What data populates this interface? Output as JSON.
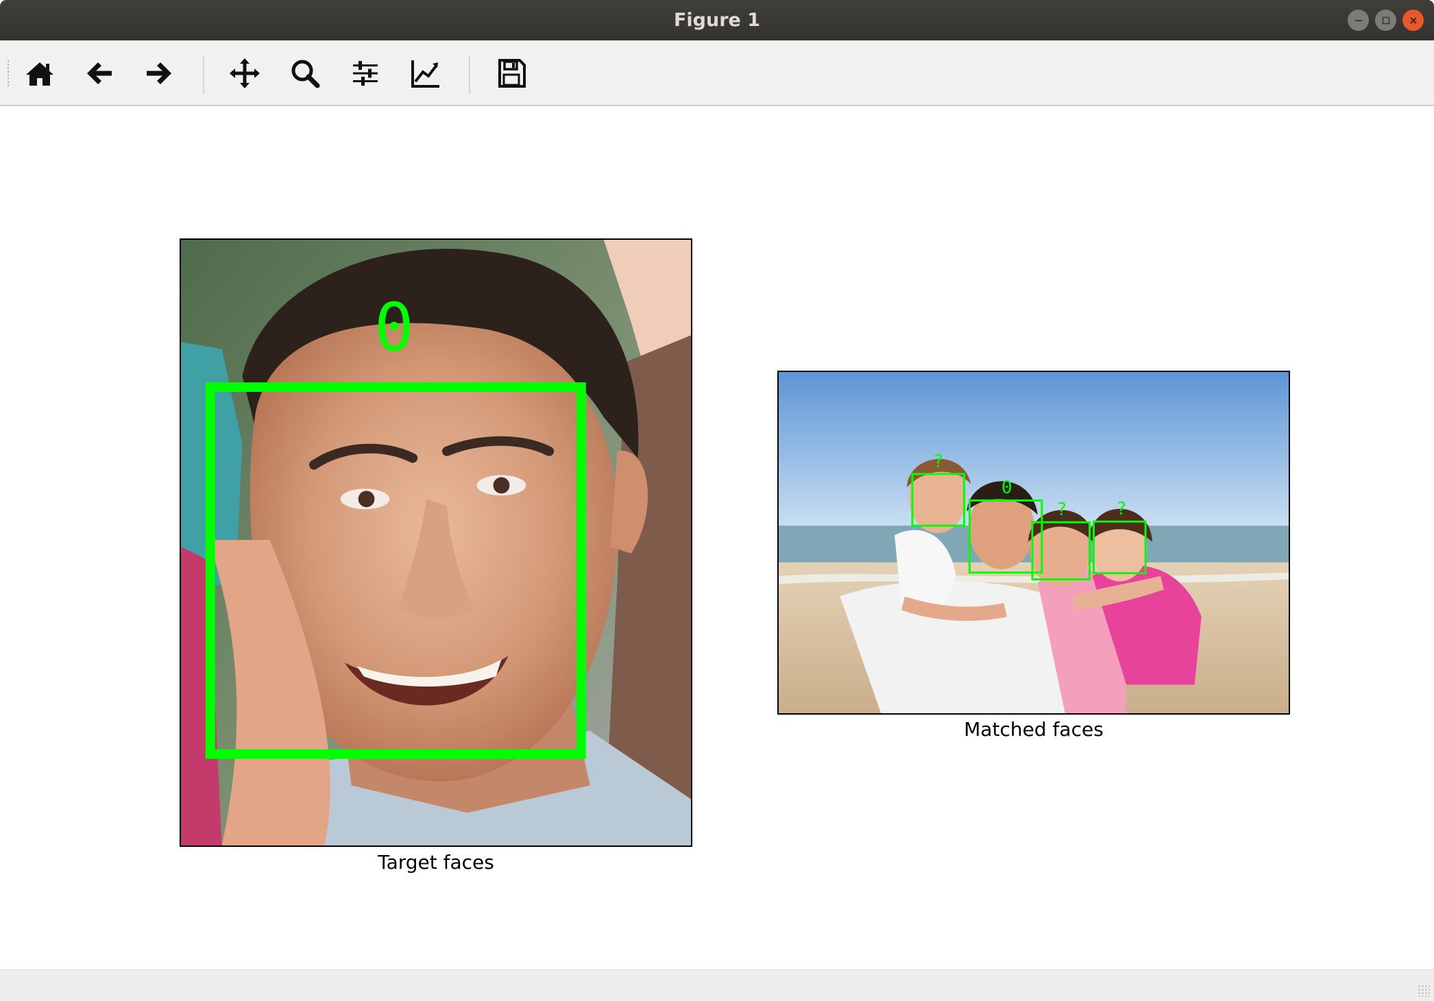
{
  "window": {
    "title": "Figure 1"
  },
  "toolbar": {
    "buttons": [
      {
        "icon": "home-icon",
        "tooltip": "Reset original view"
      },
      {
        "icon": "back-arrow-icon",
        "tooltip": "Back to previous view"
      },
      {
        "icon": "forward-arrow-icon",
        "tooltip": "Forward to next view"
      },
      {
        "icon": "pan-icon",
        "tooltip": "Pan axes"
      },
      {
        "icon": "zoom-icon",
        "tooltip": "Zoom to rectangle"
      },
      {
        "icon": "configure-subplots-icon",
        "tooltip": "Configure subplots"
      },
      {
        "icon": "edit-axis-icon",
        "tooltip": "Edit axis, curve and image parameters"
      },
      {
        "icon": "save-icon",
        "tooltip": "Save the figure"
      }
    ]
  },
  "figure": {
    "left_panel": {
      "xlabel": "Target faces",
      "face_labels": [
        "0"
      ]
    },
    "right_panel": {
      "xlabel": "Matched faces",
      "face_labels": [
        "?",
        "0",
        "?",
        "?"
      ]
    },
    "box_color": "#00ff00"
  }
}
